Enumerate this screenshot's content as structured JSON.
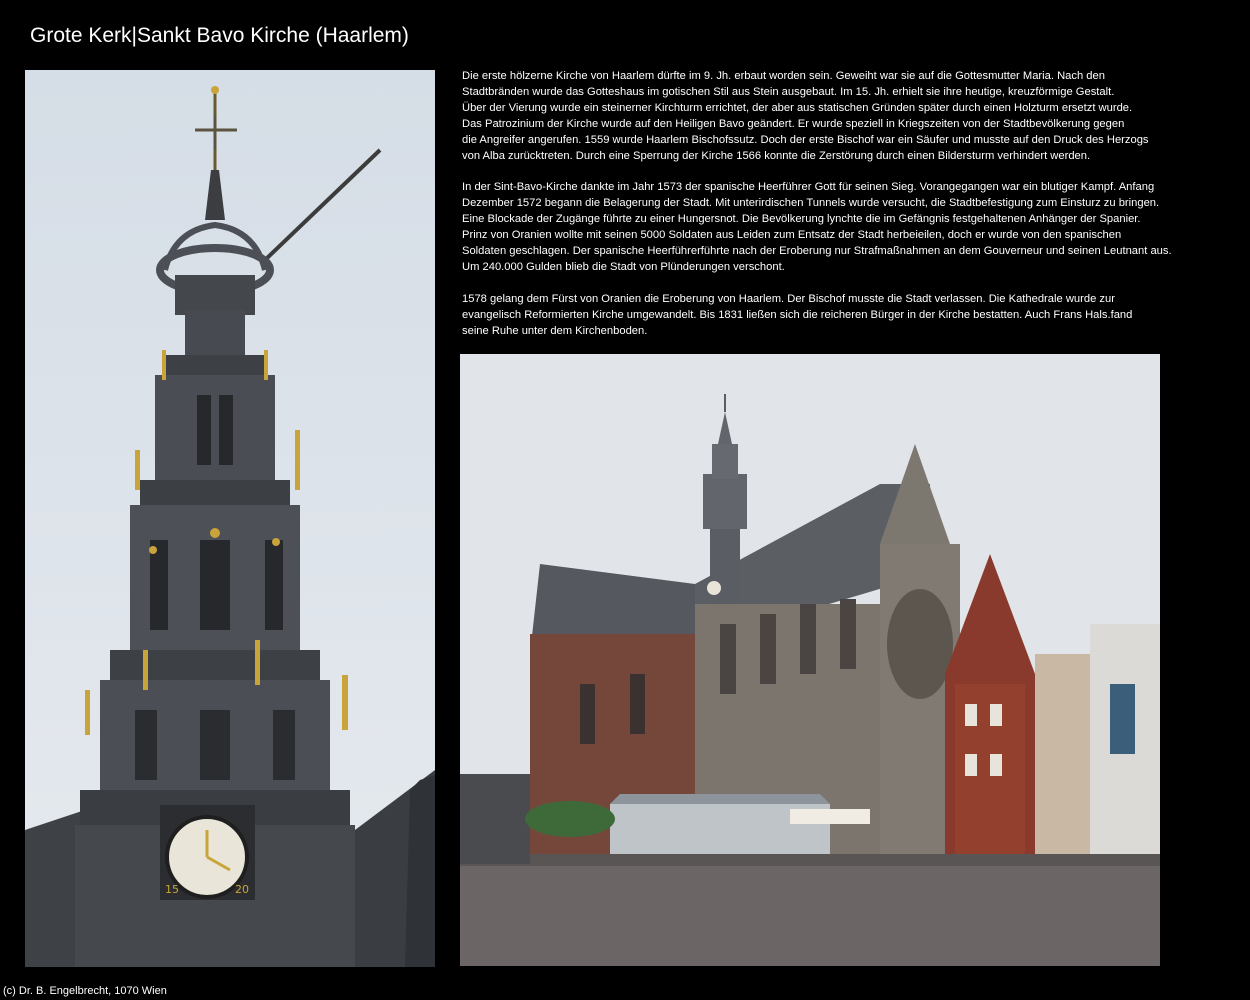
{
  "page": {
    "title": "Grote Kerk|Sankt Bavo Kirche (Haarlem)",
    "footer": "(c) Dr. B. Engelbrecht, 1070 Wien"
  },
  "body_text": {
    "paragraph_1": "Die erste hölzerne Kirche von Haarlem dürfte im 9. Jh. erbaut worden sein. Geweiht war sie auf die Gottesmutter Maria. Nach den\nStadtbränden wurde das Gotteshaus im gotischen Stil aus Stein ausgebaut. Im 15. Jh. erhielt sie ihre heutige, kreuzförmige Gestalt.\nÜber der Vierung wurde ein steinerner Kirchturm errichtet, der aber aus statischen Gründen später durch einen Holzturm ersetzt wurde.\nDas Patrozinium der Kirche wurde auf den Heiligen Bavo geändert. Er wurde speziell in Kriegszeiten von der Stadtbevölkerung gegen\ndie Angreifer angerufen. 1559 wurde Haarlem Bischofssutz. Doch der erste Bischof war ein Säufer und musste auf den Druck des Herzogs\nvon Alba zurücktreten. Durch eine Sperrung der Kirche 1566 konnte die Zerstörung durch einen Bildersturm verhindert werden.",
    "paragraph_2": "In der Sint-Bavo-Kirche dankte im Jahr 1573 der spanische Heerführer Gott für seinen Sieg. Vorangegangen war ein blutiger Kampf. Anfang\nDezember 1572 begann die Belagerung der Stadt. Mit unterirdischen Tunnels wurde versucht, die Stadtbefestigung zum Einsturz zu bringen.\nEine Blockade der Zugänge führte zu einer Hungersnot. Die Bevölkerung lynchte die im Gefängnis festgehaltenen Anhänger der Spanier.\nPrinz von Oranien wollte mit seinen 5000 Soldaten aus Leiden zum Entsatz der Stadt herbeieilen, doch er wurde von den spanischen\nSoldaten geschlagen. Der spanische Heerführerführte nach der Eroberung nur Strafmaßnahmen an dem Gouverneur und seinen Leutnant aus.\nUm 240.000 Gulden blieb die Stadt von Plünderungen verschont.",
    "paragraph_3": "1578 gelang dem Fürst von Oranien die Eroberung von Haarlem. Der Bischof musste die Stadt verlassen. Die Kathedrale wurde zur\nevangelisch Reformierten Kirche umgewandelt. Bis 1831 ließen sich die reicheren Bürger in der Kirche bestatten. Auch Frans Hals.fand\nseine Ruhe unter dem Kirchenboden."
  },
  "photos": {
    "left": {
      "subject": "tower-closeup",
      "clock_numerals": [
        "15",
        "20"
      ]
    },
    "right": {
      "subject": "church-exterior-square"
    }
  },
  "colors": {
    "background": "#000000",
    "text": "#ffffff",
    "sky": "#dde3ea",
    "stone": "#4a4d52",
    "gold": "#c9a43a",
    "brick": "#8a3a2c"
  }
}
